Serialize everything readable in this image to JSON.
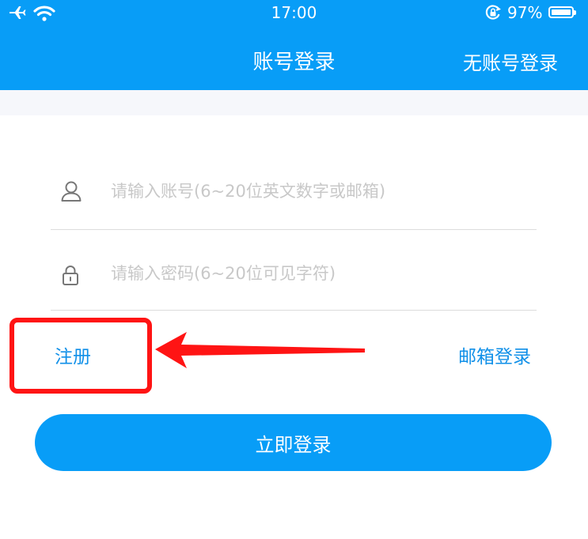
{
  "status_bar": {
    "time": "17:00",
    "battery_percent": "97%",
    "battery_level": 0.97
  },
  "nav": {
    "title": "账号登录",
    "right_action": "无账号登录"
  },
  "form": {
    "account_placeholder": "请输入账号(6~20位英文数字或邮箱)",
    "password_placeholder": "请输入密码(6~20位可见字符)",
    "register_label": "注册",
    "email_login_label": "邮箱登录",
    "submit_label": "立即登录"
  },
  "colors": {
    "brand_blue": "#089DF7",
    "link_blue": "#1190E8",
    "annotation_red": "#FF1414",
    "band_gray": "#F6F7FB"
  },
  "icons": [
    "airplane-icon",
    "wifi-icon",
    "rotation-lock-icon",
    "battery-icon",
    "user-icon",
    "lock-icon",
    "arrow-left-icon"
  ]
}
